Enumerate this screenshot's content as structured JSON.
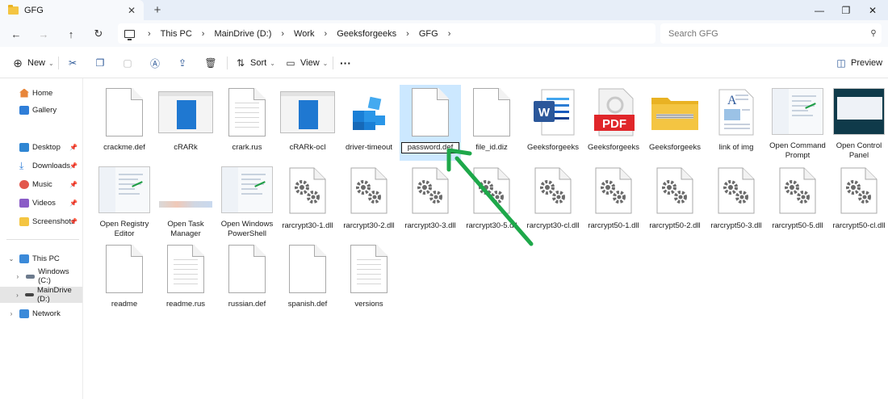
{
  "window": {
    "tab_title": "GFG",
    "close_tab": "✕",
    "new_tab": "+",
    "minimize": "—",
    "maximize": "❐",
    "close": "✕"
  },
  "nav": {
    "back": "←",
    "forward": "→",
    "up": "↑",
    "refresh": "↻"
  },
  "breadcrumb": [
    "This PC",
    "MainDrive (D:)",
    "Work",
    "Geeksforgeeks",
    "GFG"
  ],
  "search": {
    "placeholder": "Search GFG"
  },
  "commands": {
    "new": "New",
    "sort": "Sort",
    "view": "View",
    "more": "···",
    "preview": "Preview"
  },
  "sidebar": {
    "home": "Home",
    "gallery": "Gallery",
    "desktop": "Desktop",
    "downloads": "Downloads",
    "music": "Music",
    "videos": "Videos",
    "screenshots": "Screenshots",
    "this_pc": "This PC",
    "windows_c": "Windows (C:)",
    "maindrive_d": "MainDrive (D:)",
    "network": "Network"
  },
  "files": [
    {
      "name": "crackme.def",
      "kind": "page"
    },
    {
      "name": "cRARk",
      "kind": "app"
    },
    {
      "name": "crark.rus",
      "kind": "lined"
    },
    {
      "name": "cRARk-ocl",
      "kind": "app"
    },
    {
      "name": "driver-timeout",
      "kind": "registry"
    },
    {
      "name": "password.def",
      "kind": "page",
      "selected": true
    },
    {
      "name": "file_id.diz",
      "kind": "page"
    },
    {
      "name": "Geeksforgeeks",
      "kind": "word"
    },
    {
      "name": "Geeksforgeeks",
      "kind": "pdf"
    },
    {
      "name": "Geeksforgeeks",
      "kind": "zip"
    },
    {
      "name": "link of img",
      "kind": "doc-img"
    },
    {
      "name": "Open Command Prompt",
      "kind": "shot"
    },
    {
      "name": "Open Control Panel",
      "kind": "shot-dark"
    },
    {
      "name": "Open Registry Editor",
      "kind": "shot"
    },
    {
      "name": "Open Task Manager",
      "kind": "strip"
    },
    {
      "name": "Open Windows PowerShell",
      "kind": "shot"
    },
    {
      "name": "rarcrypt30-1.dll",
      "kind": "gear"
    },
    {
      "name": "rarcrypt30-2.dll",
      "kind": "gear"
    },
    {
      "name": "rarcrypt30-3.dll",
      "kind": "gear"
    },
    {
      "name": "rarcrypt30-5.dll",
      "kind": "gear"
    },
    {
      "name": "rarcrypt30-cl.dll",
      "kind": "gear"
    },
    {
      "name": "rarcrypt50-1.dll",
      "kind": "gear"
    },
    {
      "name": "rarcrypt50-2.dll",
      "kind": "gear"
    },
    {
      "name": "rarcrypt50-3.dll",
      "kind": "gear"
    },
    {
      "name": "rarcrypt50-5.dll",
      "kind": "gear"
    },
    {
      "name": "rarcrypt50-cl.dll",
      "kind": "gear"
    },
    {
      "name": "readme",
      "kind": "page"
    },
    {
      "name": "readme.rus",
      "kind": "lined"
    },
    {
      "name": "russian.def",
      "kind": "page"
    },
    {
      "name": "spanish.def",
      "kind": "page"
    },
    {
      "name": "versions",
      "kind": "lined"
    }
  ],
  "icons": {
    "word_letter": "W",
    "pdf_label": "PDF",
    "doc_letter": "A"
  },
  "colors": {
    "selection": "#cce8ff",
    "arrow": "#1ea84a",
    "word": "#2b579a",
    "pdf": "#e0262a",
    "folder": "#f4c542"
  }
}
